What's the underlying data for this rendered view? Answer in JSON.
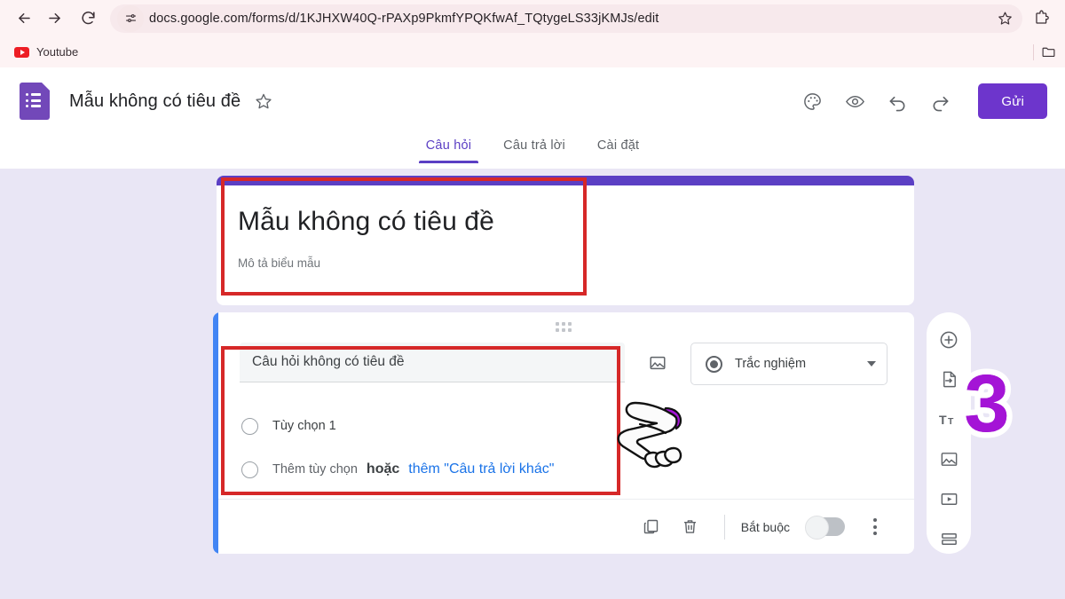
{
  "browser": {
    "url": "docs.google.com/forms/d/1KJHXW40Q-rPAXp9PkmfYPQKfwAf_TQtygeLS33jKMJs/edit",
    "back_icon": "back-arrow-icon",
    "forward_icon": "forward-arrow-icon",
    "reload_icon": "reload-icon",
    "site_settings_icon": "site-settings-icon",
    "star_icon": "bookmark-star-icon",
    "extensions_icon": "extensions-puzzle-icon",
    "bookmarks": [
      {
        "label": "Youtube",
        "icon": "youtube-icon"
      }
    ],
    "bookmark_folder_icon": "folder-icon"
  },
  "app_header": {
    "logo_icon": "google-forms-icon",
    "title": "Mẫu không có tiêu đề",
    "star_icon": "star-outline-icon",
    "actions": [
      {
        "name": "theme-button",
        "icon": "palette-icon"
      },
      {
        "name": "preview-button",
        "icon": "eye-icon"
      },
      {
        "name": "undo-button",
        "icon": "undo-icon"
      },
      {
        "name": "redo-button",
        "icon": "redo-icon"
      }
    ],
    "send_label": "Gửi"
  },
  "tabs": [
    {
      "label": "Câu hỏi",
      "active": true
    },
    {
      "label": "Câu trả lời",
      "active": false
    },
    {
      "label": "Cài đặt",
      "active": false
    }
  ],
  "title_card": {
    "heading": "Mẫu không có tiêu đề",
    "description_placeholder": "Mô tả biểu mẫu"
  },
  "question_card": {
    "drag_handle_icon": "drag-handle-icon",
    "question_title": "Câu hỏi không có tiêu đề",
    "add_image_icon": "image-icon",
    "question_type": {
      "icon": "radio-filled-icon",
      "label": "Trắc nghiệm",
      "chevron_icon": "chevron-down-icon"
    },
    "options": [
      {
        "label": "Tùy chọn 1"
      }
    ],
    "add_option": {
      "text": "Thêm tùy chọn",
      "or": "hoặc",
      "link": "thêm \"Câu trả lời khác\""
    },
    "footer": {
      "duplicate_icon": "duplicate-icon",
      "delete_icon": "trash-icon",
      "required_label": "Bắt buộc",
      "toggle_state": "off",
      "more_icon": "kebab-menu-icon"
    }
  },
  "side_toolbar": [
    {
      "name": "add-question-button",
      "icon": "circle-plus-icon"
    },
    {
      "name": "import-questions-button",
      "icon": "import-icon"
    },
    {
      "name": "add-title-button",
      "icon": "title-tt-icon"
    },
    {
      "name": "add-image-button",
      "icon": "image-icon"
    },
    {
      "name": "add-video-button",
      "icon": "video-icon"
    },
    {
      "name": "add-section-button",
      "icon": "section-icon"
    }
  ],
  "annotations": {
    "step_number": "3",
    "accent_color": "#d62828",
    "badge_color": "#a414d6",
    "cursor_icon": "pointing-hand-cursor"
  },
  "colors": {
    "brand_purple": "#6d35cc",
    "card_stripe": "#5b3fc4",
    "question_accent": "#4285f4",
    "link_blue": "#1a73e8",
    "canvas_bg": "#e9e6f5"
  }
}
